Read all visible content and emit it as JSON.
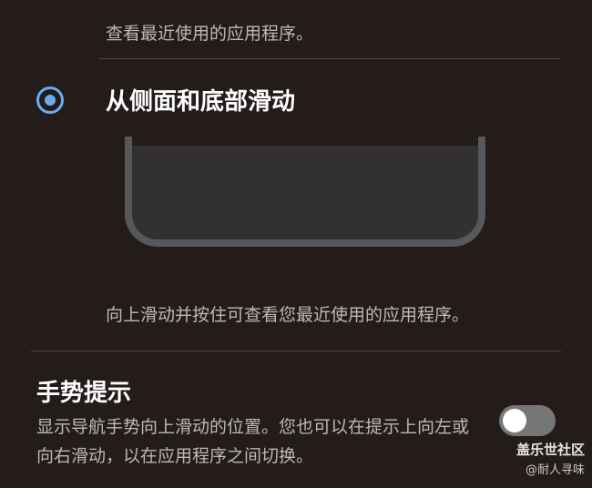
{
  "top_description_line": "查看最近使用的应用程序。",
  "navigation_option": {
    "label": "从侧面和底部滑动",
    "selected": true,
    "description": "向上滑动并按住可查看您最近使用的应用程序。"
  },
  "gesture_hint": {
    "title": "手势提示",
    "description": "显示导航手势向上滑动的位置。您也可以在提示上向左或向右滑动，以在应用程序之间切换。",
    "toggle_on": false
  },
  "watermark": {
    "title": "盖乐世社区",
    "credit": "@耐人寻味"
  },
  "colors": {
    "background": "#231c1a",
    "accent_radio": "#6cabf0",
    "toggle_off": "#767676"
  }
}
